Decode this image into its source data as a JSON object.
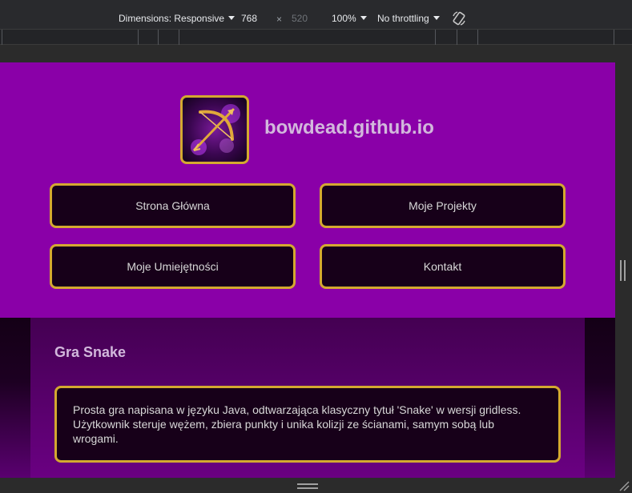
{
  "devtools": {
    "dimensions_label": "Dimensions: Responsive",
    "width_value": "768",
    "times_sign": "×",
    "height_value": "520",
    "zoom_label": "100%",
    "throttling_label": "No throttling",
    "icons": {
      "rotate": "rotate-icon",
      "dropdown": "chevron-down-icon"
    }
  },
  "site": {
    "title": "bowdead.github.io",
    "logo_icon": "bow-and-arrow-icon",
    "nav": [
      {
        "label": "Strona Główna"
      },
      {
        "label": "Moje Projekty"
      },
      {
        "label": "Moje Umiejętności"
      },
      {
        "label": "Kontakt"
      }
    ],
    "project": {
      "title": "Gra Snake",
      "description": "Prosta gra napisana w języku Java, odtwarzająca klasyczny tytuł 'Snake' w wersji gridless. Użytkownik steruje wężem, zbiera punkty i unika kolizji ze ścianami, samym sobą lub wrogami."
    },
    "colors": {
      "header_bg": "#8a00a8",
      "button_bg": "#170019",
      "accent_gold": "#d4a930",
      "title_text": "#d2b8dc"
    }
  }
}
